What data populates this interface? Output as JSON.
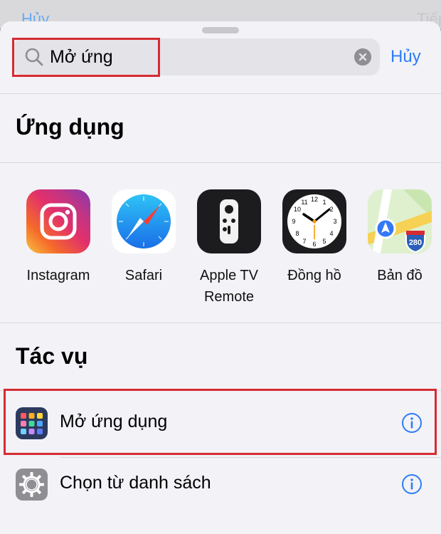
{
  "backdrop": {
    "left_text": "Hủy",
    "right_text": "Tiếp"
  },
  "search": {
    "value": "Mở ứng",
    "icon": "search-icon",
    "clear_icon": "clear-icon",
    "cancel_label": "Hủy"
  },
  "apps_section": {
    "title": "Ứng dụng",
    "items": [
      {
        "label": "Instagram",
        "icon": "instagram-icon"
      },
      {
        "label": "Safari",
        "icon": "safari-icon"
      },
      {
        "label": "Apple TV\nRemote",
        "icon": "apple-tv-remote-icon"
      },
      {
        "label": "Đồng hồ",
        "icon": "clock-icon"
      },
      {
        "label": "Bản đồ",
        "icon": "maps-icon"
      }
    ]
  },
  "actions_section": {
    "title": "Tác vụ",
    "items": [
      {
        "label": "Mở ứng dụng",
        "icon": "app-grid-icon",
        "info_icon": "info-icon"
      },
      {
        "label": "Chọn từ danh sách",
        "icon": "gear-icon",
        "info_icon": "info-icon"
      }
    ]
  },
  "colors": {
    "accent": "#2f7cf6",
    "highlight": "#d62b33",
    "sheet_bg": "#f2f2f7"
  }
}
